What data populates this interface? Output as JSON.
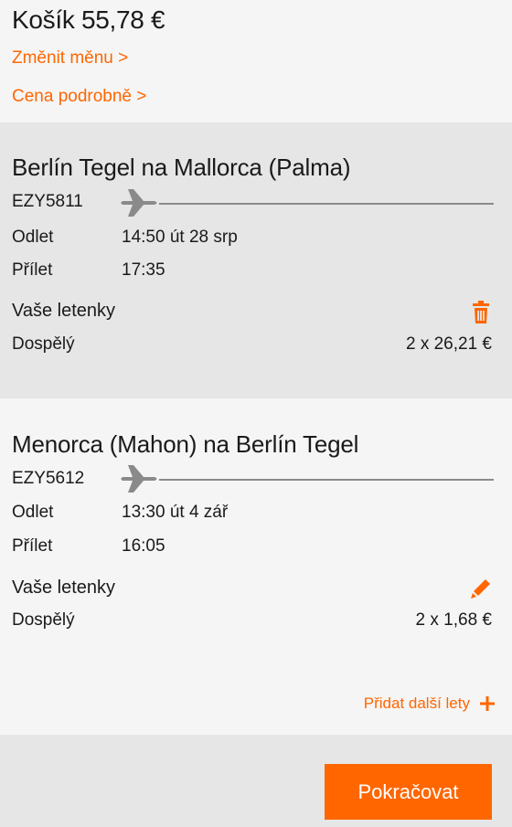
{
  "cart": {
    "title": "Košík 55,78 €",
    "change_currency": "Změnit měnu >",
    "price_detail": "Cena podrobně >"
  },
  "flights": [
    {
      "route": "Berlín Tegel na Mallorca (Palma)",
      "code": "EZY5811",
      "departure_label": "Odlet",
      "departure_value": "14:50 út 28 srp",
      "arrival_label": "Přílet",
      "arrival_value": "17:35",
      "tickets_label": "Vaše letenky",
      "passenger_label": "Dospělý",
      "price": "2 x 26,21 €",
      "action_icon": "trash-icon"
    },
    {
      "route": "Menorca (Mahon) na Berlín Tegel",
      "code": "EZY5612",
      "departure_label": "Odlet",
      "departure_value": "13:30 út 4 zář",
      "arrival_label": "Přílet",
      "arrival_value": "16:05",
      "tickets_label": "Vaše letenky",
      "passenger_label": "Dospělý",
      "price": "2 x 1,68 €",
      "action_icon": "pencil-icon"
    }
  ],
  "add_flights": {
    "label": "Přidat další lety"
  },
  "footer": {
    "continue_label": "Pokračovat"
  },
  "colors": {
    "accent": "#ff6600",
    "panel_dark": "#e6e6e6",
    "panel_light": "#f5f5f5"
  }
}
